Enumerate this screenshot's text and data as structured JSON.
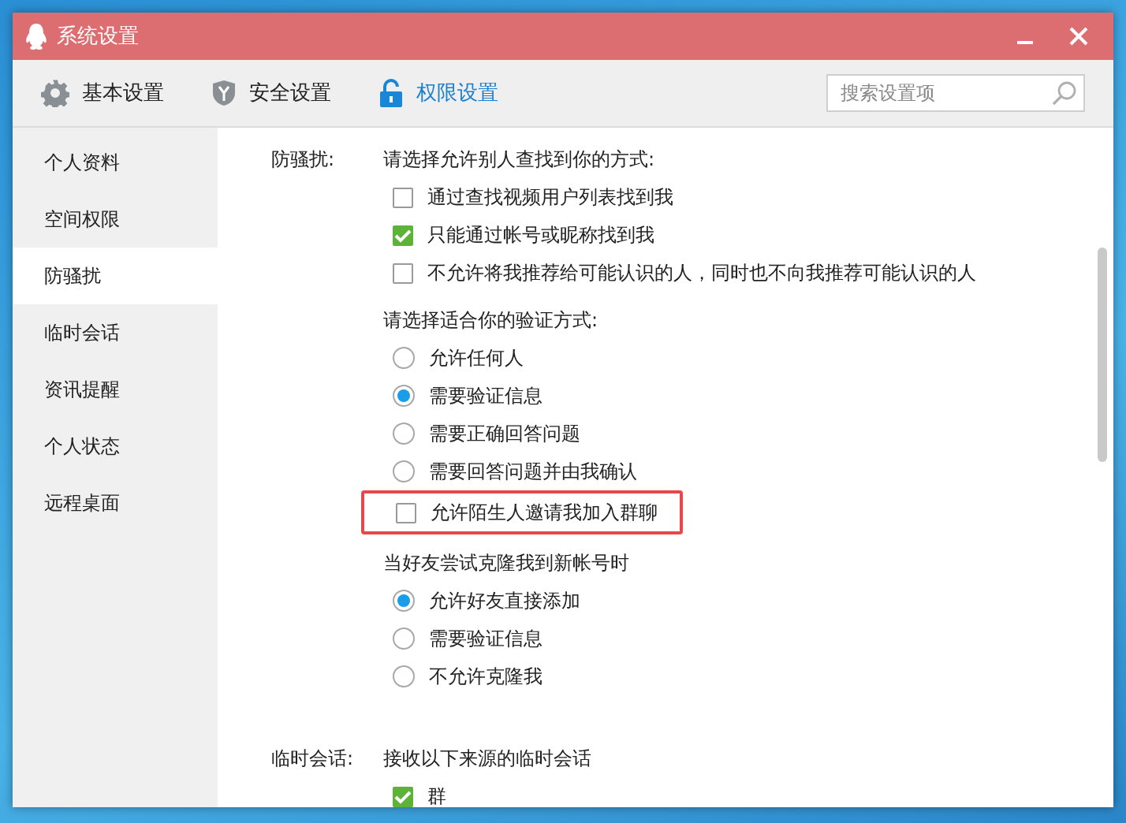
{
  "window": {
    "title": "系统设置"
  },
  "toolbar": {
    "tabs": [
      {
        "label": "基本设置",
        "kind": "gear",
        "selected": false
      },
      {
        "label": "安全设置",
        "kind": "shield",
        "selected": false
      },
      {
        "label": "权限设置",
        "kind": "lock",
        "selected": true
      }
    ],
    "search": {
      "placeholder": "搜索设置项"
    }
  },
  "sidebar": {
    "items": [
      {
        "label": "个人资料",
        "selected": false
      },
      {
        "label": "空间权限",
        "selected": false
      },
      {
        "label": "防骚扰",
        "selected": true
      },
      {
        "label": "临时会话",
        "selected": false
      },
      {
        "label": "资讯提醒",
        "selected": false
      },
      {
        "label": "个人状态",
        "selected": false
      },
      {
        "label": "远程桌面",
        "selected": false
      }
    ]
  },
  "sections": [
    {
      "label": "防骚扰:",
      "groups": [
        {
          "heading": "请选择允许别人查找到你的方式:",
          "options": [
            {
              "kind": "checkbox",
              "label": "通过查找视频用户列表找到我",
              "checked": false,
              "highlighted": false
            },
            {
              "kind": "checkbox",
              "label": "只能通过帐号或昵称找到我",
              "checked": true,
              "highlighted": false
            },
            {
              "kind": "checkbox",
              "label": "不允许将我推荐给可能认识的人，同时也不向我推荐可能认识的人",
              "checked": false,
              "highlighted": false
            }
          ]
        },
        {
          "heading": "请选择适合你的验证方式:",
          "options": [
            {
              "kind": "radio",
              "label": "允许任何人",
              "selected": false,
              "highlighted": false
            },
            {
              "kind": "radio",
              "label": "需要验证信息",
              "selected": true,
              "highlighted": false
            },
            {
              "kind": "radio",
              "label": "需要正确回答问题",
              "selected": false,
              "highlighted": false
            },
            {
              "kind": "radio",
              "label": "需要回答问题并由我确认",
              "selected": false,
              "highlighted": false
            },
            {
              "kind": "checkbox",
              "label": "允许陌生人邀请我加入群聊",
              "checked": false,
              "highlighted": true
            }
          ]
        },
        {
          "heading": "当好友尝试克隆我到新帐号时",
          "options": [
            {
              "kind": "radio",
              "label": "允许好友直接添加",
              "selected": true,
              "highlighted": false
            },
            {
              "kind": "radio",
              "label": "需要验证信息",
              "selected": false,
              "highlighted": false
            },
            {
              "kind": "radio",
              "label": "不允许克隆我",
              "selected": false,
              "highlighted": false
            }
          ]
        }
      ]
    },
    {
      "label": "临时会话:",
      "groups": [
        {
          "heading": "接收以下来源的临时会话",
          "options": [
            {
              "kind": "checkbox",
              "label": "群",
              "checked": true,
              "highlighted": false
            }
          ]
        }
      ]
    }
  ]
}
